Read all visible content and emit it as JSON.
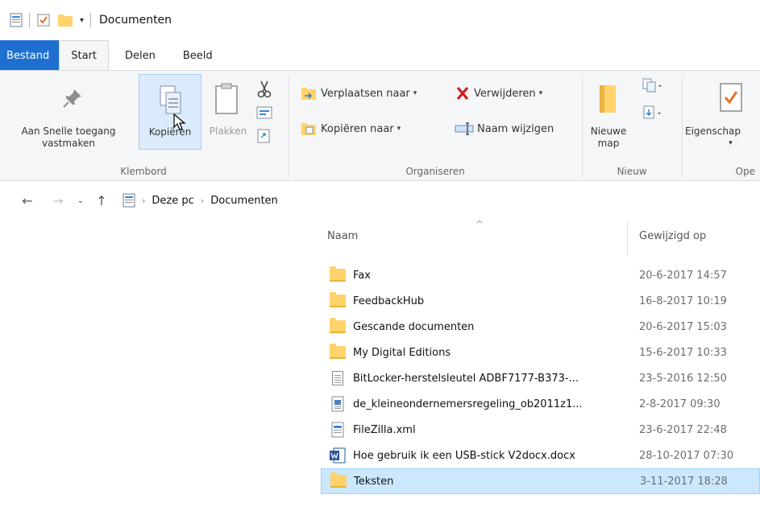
{
  "window": {
    "title": "Documenten"
  },
  "tabs": [
    {
      "label": "Bestand"
    },
    {
      "label": "Start"
    },
    {
      "label": "Delen"
    },
    {
      "label": "Beeld"
    }
  ],
  "ribbon": {
    "klembord": {
      "label": "Klembord",
      "pin_line1": "Aan Snelle toegang",
      "pin_line2": "vastmaken",
      "copy": "Kopiëren",
      "paste": "Plakken"
    },
    "organiseren": {
      "label": "Organiseren",
      "move_to": "Verplaatsen naar",
      "copy_to": "Kopiëren naar",
      "delete": "Verwijderen",
      "rename": "Naam wijzigen"
    },
    "nieuw": {
      "label": "Nieuw",
      "new_folder_line1": "Nieuwe",
      "new_folder_line2": "map"
    },
    "openen": {
      "label": "Ope",
      "properties": "Eigenschap"
    }
  },
  "address": {
    "crumbs": [
      "Deze pc",
      "Documenten"
    ]
  },
  "columns": {
    "name": "Naam",
    "modified": "Gewijzigd op"
  },
  "files": [
    {
      "name": "Fax",
      "modified": "20-6-2017 14:57",
      "icon": "folder-icon"
    },
    {
      "name": "FeedbackHub",
      "modified": "16-8-2017 10:19",
      "icon": "folder-icon"
    },
    {
      "name": "Gescande documenten",
      "modified": "20-6-2017 15:03",
      "icon": "folder-icon"
    },
    {
      "name": "My Digital Editions",
      "modified": "15-6-2017 10:33",
      "icon": "folder-icon"
    },
    {
      "name": "BitLocker-herstelsleutel ADBF7177-B373-...",
      "modified": "23-5-2016 12:50",
      "icon": "text-file-icon"
    },
    {
      "name": "de_kleineondernemersregeling_ob2011z1...",
      "modified": "2-8-2017 09:30",
      "icon": "pdf-file-icon"
    },
    {
      "name": "FileZilla.xml",
      "modified": "23-6-2017 22:48",
      "icon": "xml-file-icon"
    },
    {
      "name": "Hoe gebruik ik een USB-stick V2docx.docx",
      "modified": "28-10-2017 07:30",
      "icon": "word-file-icon"
    },
    {
      "name": "Teksten",
      "modified": "3-11-2017 18:28",
      "icon": "folder-icon"
    }
  ],
  "colors": {
    "file_tab": "#1e6fcf",
    "selection": "#cce8ff",
    "folder": "#ffd36b",
    "delete_red": "#d11c1c"
  }
}
